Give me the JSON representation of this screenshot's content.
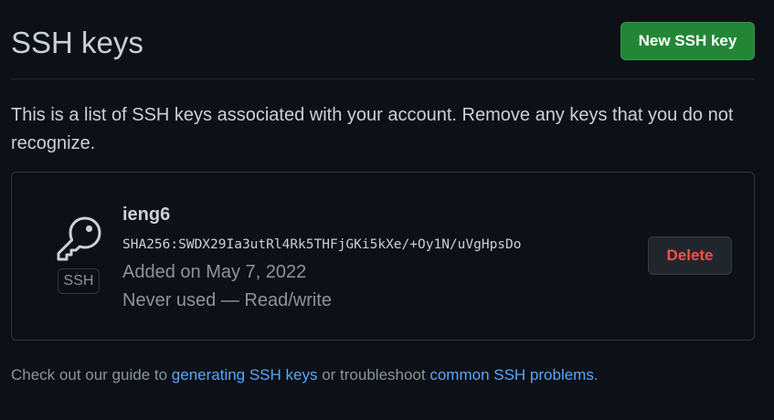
{
  "header": {
    "title": "SSH keys",
    "new_key_button": "New SSH key"
  },
  "description": "This is a list of SSH keys associated with your account. Remove any keys that you do not recognize.",
  "keys": [
    {
      "title": "ieng6",
      "badge": "SSH",
      "icon": "key-icon",
      "fingerprint": "SHA256:SWDX29Ia3utRl4Rk5THFjGKi5kXe/+Oy1N/uVgHpsDo",
      "added": "Added on May 7, 2022",
      "usage": "Never used — Read/write",
      "delete_label": "Delete"
    }
  ],
  "footer": {
    "text_before": "Check out our guide to ",
    "link1": "generating SSH keys",
    "text_middle": " or troubleshoot ",
    "link2": "common SSH problems",
    "text_after": "."
  },
  "colors": {
    "background": "#0d1117",
    "primary_button": "#238636",
    "danger_text": "#f85149",
    "link": "#58a6ff",
    "muted_text": "#8b949e"
  }
}
